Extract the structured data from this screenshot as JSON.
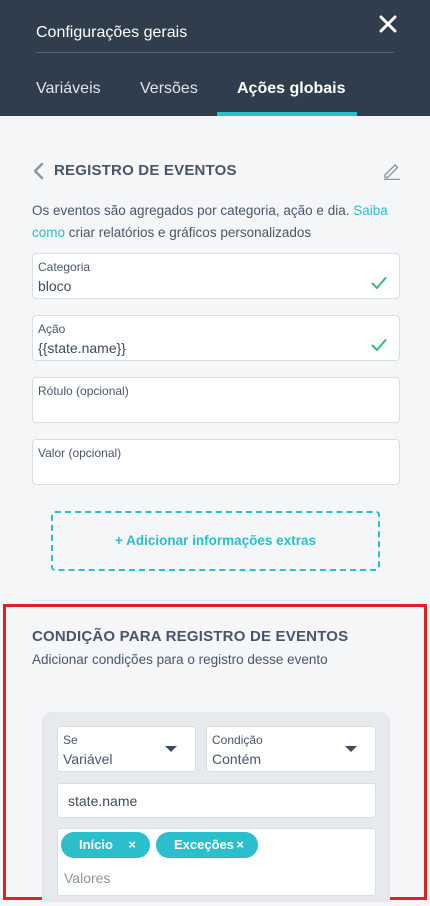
{
  "header": {
    "title": "Configurações gerais",
    "tabs": [
      {
        "label": "Variáveis"
      },
      {
        "label": "Versões"
      },
      {
        "label": "Ações globais"
      }
    ]
  },
  "section": {
    "title": "REGISTRO DE EVENTOS",
    "desc_prefix": "Os eventos são agregados por categoria, ação e dia. ",
    "desc_link": "Saiba como",
    "desc_suffix": " criar relatórios e gráficos personalizados"
  },
  "fields": {
    "category": {
      "label": "Categoria",
      "value": "bloco"
    },
    "action": {
      "label": "Ação",
      "value": "{{state.name}}"
    },
    "label_opt": {
      "label": "Rótulo (opcional)",
      "value": ""
    },
    "value_opt": {
      "label": "Valor (opcional)",
      "value": ""
    }
  },
  "add_extra_label": "+ Adicionar informações extras",
  "condition": {
    "title": "CONDIÇÃO PARA REGISTRO DE EVENTOS",
    "subtitle": "Adicionar condições para o registro desse evento",
    "if_select": {
      "label": "Se",
      "value": "Variável"
    },
    "cond_select": {
      "label": "Condição",
      "value": "Contém"
    },
    "variable_value": "state.name",
    "chips": [
      "Início",
      "Exceções"
    ],
    "values_placeholder": "Valores"
  },
  "colors": {
    "header_bg": "#2f3d4d",
    "accent": "#2bbecb",
    "highlight_border": "#e02024",
    "check": "#3fb67a"
  },
  "icons": [
    "close-icon",
    "chevron-left-icon",
    "pencil-icon",
    "check-icon",
    "caret-down-icon",
    "chip-remove-icon"
  ]
}
